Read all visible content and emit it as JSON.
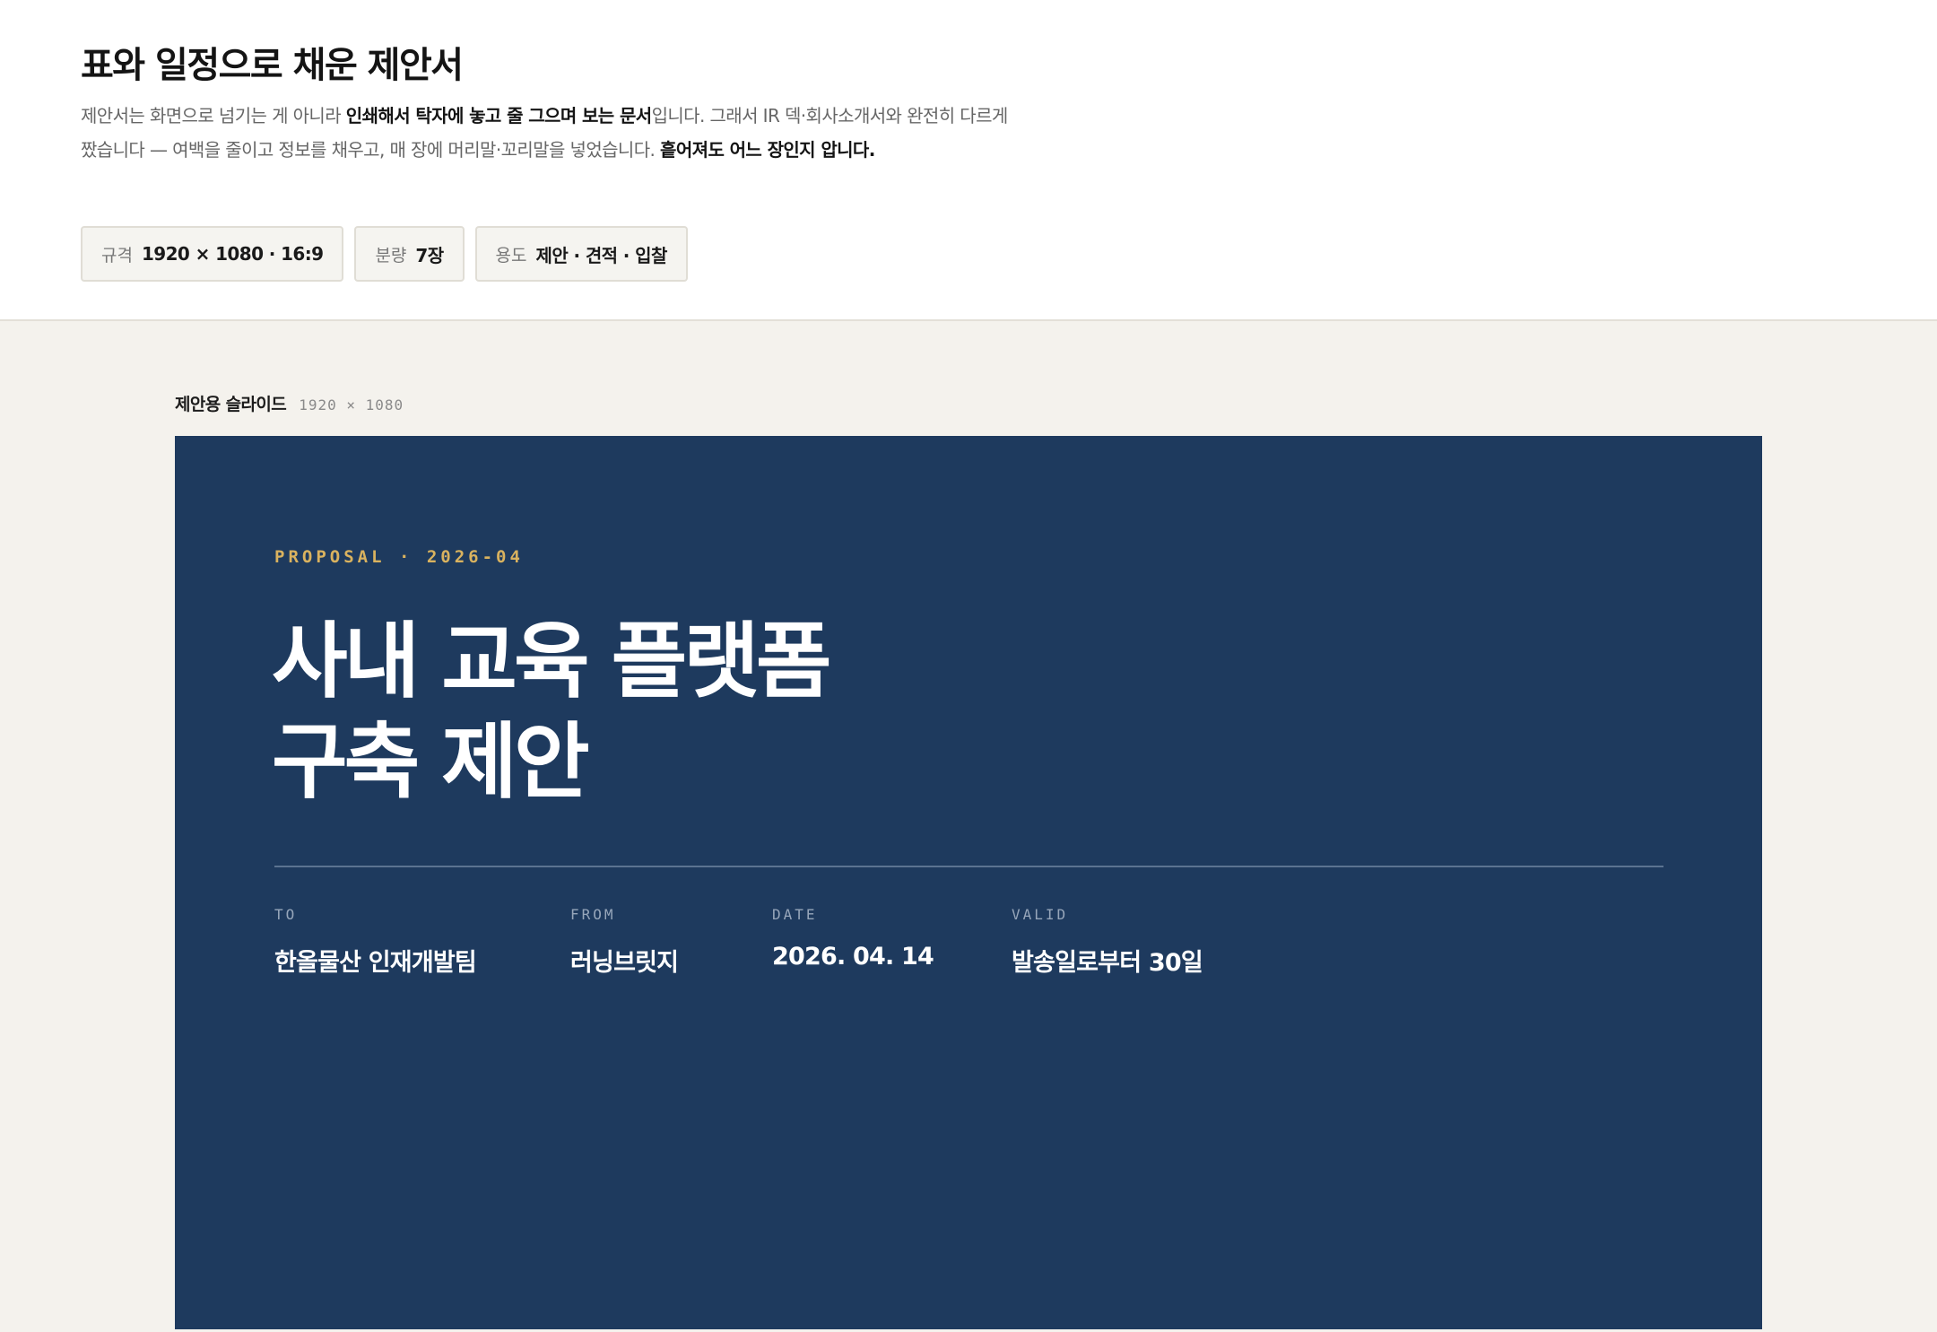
{
  "header": {
    "title": "표와 일정으로 채운 제안서",
    "description": {
      "t1": "제안서는 화면으로 넘기는 게 아니라 ",
      "b1": "인쇄해서 탁자에 놓고 줄 그으며 보는 문서",
      "t2": "입니다. 그래서 IR 덱·회사소개서와 완전히 다르게 짰습니다 — 여백을 줄이고 정보를 채우고, 매 장에 머리말·꼬리말을 넣었습니다. ",
      "b2": "흩어져도 어느 장인지 압니다."
    },
    "chips": [
      {
        "key": "규격",
        "value": "1920 × 1080 · 16:9"
      },
      {
        "key": "분량",
        "value": "7장"
      },
      {
        "key": "용도",
        "value": "제안 · 견적 · 입찰"
      }
    ]
  },
  "preview": {
    "label": "제안용 슬라이드",
    "size": "1920 × 1080"
  },
  "slide": {
    "eyebrow": "PROPOSAL · 2026-04",
    "title_line1": "사내 교육 플랫폼",
    "title_line2": "구축 제안",
    "meta": [
      {
        "key": "TO",
        "value": "한올물산 인재개발팀"
      },
      {
        "key": "FROM",
        "value": "러닝브릿지"
      },
      {
        "key": "DATE",
        "value": "2026. 04. 14"
      },
      {
        "key": "VALID",
        "value": "발송일로부터 30일"
      }
    ]
  },
  "colors": {
    "slide_background": "#1e3a5e",
    "eyebrow_accent": "#d9b25f",
    "page_background": "#f4f2ed"
  }
}
